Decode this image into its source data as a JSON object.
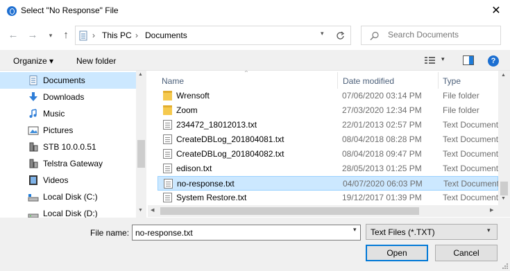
{
  "window": {
    "title": "Select \"No Response\" File",
    "close_glyph": "✕"
  },
  "address": {
    "crumbs": [
      "This PC",
      "Documents"
    ],
    "separator": "›"
  },
  "search": {
    "placeholder": "Search Documents"
  },
  "toolbar": {
    "organize_label": "Organize ▾",
    "new_folder_label": "New folder",
    "help_glyph": "?"
  },
  "nav": {
    "items": [
      {
        "label": "Documents",
        "icon": "documents-icon",
        "selected": true
      },
      {
        "label": "Downloads",
        "icon": "downloads-icon"
      },
      {
        "label": "Music",
        "icon": "music-icon"
      },
      {
        "label": "Pictures",
        "icon": "pictures-icon"
      },
      {
        "label": "STB 10.0.0.51",
        "icon": "network-device-icon"
      },
      {
        "label": "Telstra Gateway",
        "icon": "network-device-icon"
      },
      {
        "label": "Videos",
        "icon": "videos-icon"
      },
      {
        "label": "Local Disk (C:)",
        "icon": "drive-icon"
      },
      {
        "label": "Local Disk (D:)",
        "icon": "drive-icon"
      }
    ]
  },
  "files": {
    "columns": {
      "name": "Name",
      "date": "Date modified",
      "type": "Type"
    },
    "rows": [
      {
        "name": "Wrensoft",
        "date": "07/06/2020 03:14 PM",
        "type": "File folder",
        "icon": "folder-icon"
      },
      {
        "name": "Zoom",
        "date": "27/03/2020 12:34 PM",
        "type": "File folder",
        "icon": "folder-icon"
      },
      {
        "name": "234472_18012013.txt",
        "date": "22/01/2013 02:57 PM",
        "type": "Text Document",
        "icon": "text-file-icon"
      },
      {
        "name": "CreateDBLog_201804081.txt",
        "date": "08/04/2018 08:28 PM",
        "type": "Text Document",
        "icon": "text-file-icon"
      },
      {
        "name": "CreateDBLog_201804082.txt",
        "date": "08/04/2018 09:47 PM",
        "type": "Text Document",
        "icon": "text-file-icon"
      },
      {
        "name": "edison.txt",
        "date": "28/05/2013 01:25 PM",
        "type": "Text Document",
        "icon": "text-file-icon"
      },
      {
        "name": "no-response.txt",
        "date": "04/07/2020 06:03 PM",
        "type": "Text Document",
        "icon": "text-file-icon",
        "selected": true
      },
      {
        "name": "System Restore.txt",
        "date": "19/12/2017 01:39 PM",
        "type": "Text Document",
        "icon": "text-file-icon"
      }
    ]
  },
  "footer": {
    "filename_label": "File name:",
    "filename_value": "no-response.txt",
    "filetype_value": "Text Files (*.TXT)",
    "open_label": "Open",
    "cancel_label": "Cancel"
  }
}
